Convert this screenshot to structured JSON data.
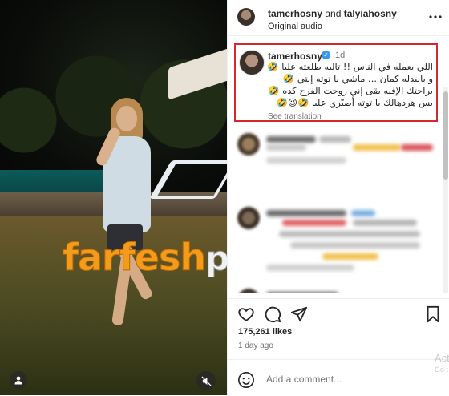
{
  "media": {
    "watermark": {
      "part1": "farfesh",
      "part2": "plus.com"
    },
    "mute_icon": "speaker-muted-icon",
    "profile_icon": "person-icon"
  },
  "header": {
    "user1": "tamerhosny",
    "and": " and ",
    "user2": "talyiahosny",
    "audio": "Original audio",
    "more_icon": "more-dots-icon"
  },
  "caption": {
    "username": "tamerhosny",
    "time": "1d",
    "lines": [
      "اللي بعمله في الناس !! تاليه طلعته عليا 🤣",
      "و بالبدله كمان ... ماشي يا توته إنتي 🤣",
      "براحتك الإفيه بقى إني روحت الفرح كده 🤣",
      "بس هردهالك يا توته أصبّري عليا 🤣😉🤣"
    ],
    "see_translation": "See translation"
  },
  "actions": {
    "like_icon": "heart-icon",
    "comment_icon": "comment-icon",
    "share_icon": "send-icon",
    "save_icon": "bookmark-icon"
  },
  "likes": "175,261 likes",
  "time_ago": "1 day ago",
  "add_comment": {
    "placeholder": "Add a comment...",
    "emoji_icon": "smiley-icon"
  },
  "overlay": {
    "line1": "Act",
    "line2": "Go t"
  },
  "colors": {
    "highlight": "#d6282c",
    "verified": "#3897f0",
    "watermark_orange": "#f49b1c"
  }
}
